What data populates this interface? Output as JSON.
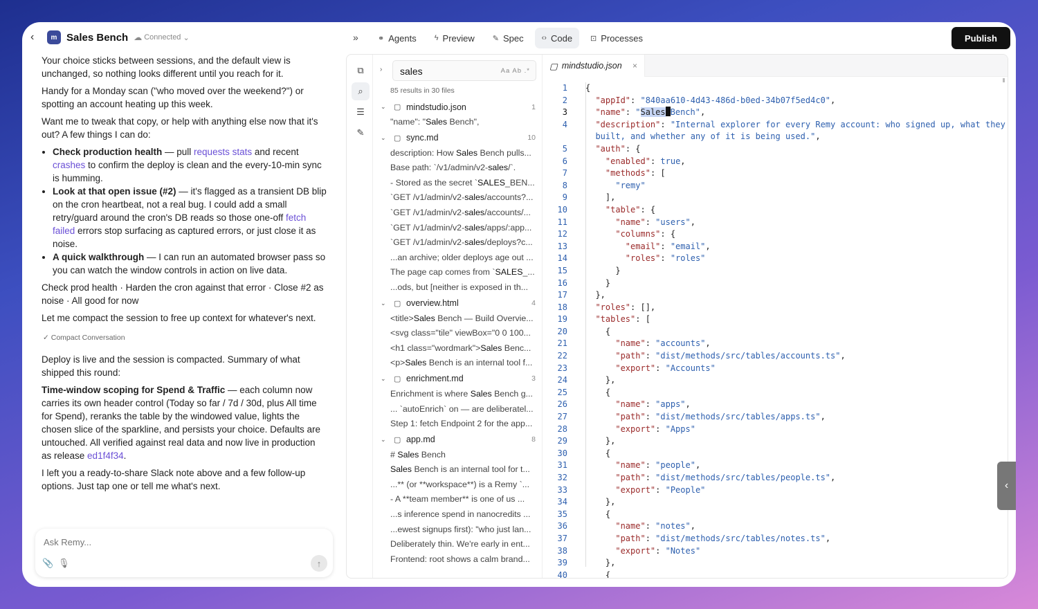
{
  "header": {
    "app_name": "Sales Bench",
    "status": "Connected",
    "logo_text": "m"
  },
  "chat": {
    "p1": "Your choice sticks between sessions, and the default view is unchanged, so nothing looks different until you reach for it.",
    "p2": "Handy for a Monday scan (\"who moved over the weekend?\") or spotting an account heating up this week.",
    "p3": "Want me to tweak that copy, or help with anything else now that it's out? A few things I can do:",
    "b1": {
      "bold": "Check production health",
      "t1": " — pull ",
      "link1": "requests stats",
      "t2": " and recent ",
      "link2": "crashes",
      "t3": " to confirm the deploy is clean and the every-10-min sync is humming."
    },
    "b2": {
      "bold": "Look at that open issue (#2)",
      "t1": " — it's flagged as a transient DB blip on the cron heartbeat, not a real bug. I could add a small retry/guard around the cron's DB reads so those one-off ",
      "link1": "fetch failed",
      "t2": " errors stop surfacing as captured errors, or just close it as noise."
    },
    "b3": {
      "bold": "A quick walkthrough",
      "t1": " — I can run an automated browser pass so you can watch the window controls in action on live data."
    },
    "p4": "Check prod health · Harden the cron against that error · Close #2 as noise · All good for now",
    "p5": "Let me compact the session to free up context for whatever's next.",
    "compact_label": "Compact Conversation",
    "p6": "Deploy is live and the session is compacted. Summary of what shipped this round:",
    "p7": {
      "bold": "Time-window scoping for Spend & Traffic",
      "t1": " — each column now carries its own header control (Today so far / 7d / 30d, plus All time for Spend), reranks the table by the windowed value, lights the chosen slice of the sparkline, and persists your choice. Defaults are untouched. All verified against real data and now live in production as release ",
      "link1": "ed1f4f34",
      "t2": "."
    },
    "p8": "I left you a ready-to-share Slack note above and a few follow-up options. Just tap one or tell me what's next.",
    "composer_placeholder": "Ask Remy..."
  },
  "nav": {
    "tabs": [
      {
        "label": "Agents",
        "icon": "agents-icon"
      },
      {
        "label": "Preview",
        "icon": "lightning-icon"
      },
      {
        "label": "Spec",
        "icon": "pencil-square-icon"
      },
      {
        "label": "Code",
        "icon": "code-icon"
      },
      {
        "label": "Processes",
        "icon": "cpu-icon"
      }
    ],
    "active_tab": "Code",
    "publish_label": "Publish"
  },
  "search": {
    "query": "sales",
    "flags": "Aa  Ab  .*",
    "summary": "85 results in 30 files",
    "files": [
      {
        "name": "mindstudio.json",
        "count": "1",
        "lines": [
          [
            "\"name\": \"",
            "Sales",
            " Bench\","
          ]
        ]
      },
      {
        "name": "sync.md",
        "count": "10",
        "lines": [
          [
            "description: How ",
            "Sales",
            " Bench pulls..."
          ],
          [
            "Base path: `/v1/admin/v2-",
            "sales",
            "/`."
          ],
          [
            "- Stored as the secret `",
            "SALES",
            "_BEN..."
          ],
          [
            "`GET /v1/admin/v2-",
            "sales",
            "/accounts?..."
          ],
          [
            "`GET /v1/admin/v2-",
            "sales",
            "/accounts/..."
          ],
          [
            "`GET /v1/admin/v2-",
            "sales",
            "/apps/:app..."
          ],
          [
            "`GET /v1/admin/v2-",
            "sales",
            "/deploys?c..."
          ],
          [
            "...an archive; older deploys age out ...",
            "",
            ""
          ],
          [
            "The page cap comes from `",
            "SALES",
            "_..."
          ],
          [
            "...ods, but [neither is exposed in th...",
            "",
            ""
          ]
        ]
      },
      {
        "name": "overview.html",
        "count": "4",
        "lines": [
          [
            "<title>",
            "Sales",
            " Bench — Build Overvie..."
          ],
          [
            "<svg class=\"tile\" viewBox=\"0 0 100...",
            "",
            ""
          ],
          [
            "<h1 class=\"wordmark\">",
            "Sales",
            " Benc..."
          ],
          [
            "<p>",
            "Sales",
            " Bench is an internal tool f..."
          ]
        ]
      },
      {
        "name": "enrichment.md",
        "count": "3",
        "lines": [
          [
            "Enrichment is where ",
            "Sales",
            " Bench g..."
          ],
          [
            "... `autoEnrich` on — are deliberatel...",
            "",
            ""
          ],
          [
            "Step 1: fetch Endpoint 2 for the app...",
            "",
            ""
          ]
        ]
      },
      {
        "name": "app.md",
        "count": "8",
        "lines": [
          [
            "# ",
            "Sales",
            " Bench"
          ],
          [
            "",
            "Sales",
            " Bench is an internal tool for t..."
          ],
          [
            "...** (or **workspace**) is a Remy `...",
            "",
            ""
          ],
          [
            "- A **team member** is one of us ...",
            "",
            ""
          ],
          [
            "...s inference spend in nanocredits ...",
            "",
            ""
          ],
          [
            "...ewest signups first): \"who just lan...",
            "",
            ""
          ],
          [
            "Deliberately thin. We're early in ent...",
            "",
            ""
          ],
          [
            "Frontend: root shows a calm brand...",
            "",
            ""
          ]
        ]
      }
    ]
  },
  "editor": {
    "tab_name": "mindstudio.json",
    "lines": [
      {
        "n": "1",
        "segs": [
          [
            "p",
            "{"
          ]
        ]
      },
      {
        "n": "2",
        "segs": [
          [
            "p",
            "  "
          ],
          [
            "k",
            "\"appId\""
          ],
          [
            "p",
            ": "
          ],
          [
            "s",
            "\"840aa610-4d43-486d-b0ed-34b07f5ed4c0\""
          ],
          [
            "p",
            ","
          ]
        ]
      },
      {
        "n": "3",
        "cur": true,
        "segs": [
          [
            "p",
            "  "
          ],
          [
            "k",
            "\"name\""
          ],
          [
            "p",
            ": "
          ],
          [
            "s",
            "\""
          ],
          [
            "hl",
            "Sales"
          ],
          [
            "caret",
            ""
          ],
          [
            "s",
            "Bench\""
          ],
          [
            "p",
            ","
          ]
        ]
      },
      {
        "n": "4",
        "segs": [
          [
            "p",
            "  "
          ],
          [
            "k",
            "\"description\""
          ],
          [
            "p",
            ": "
          ],
          [
            "s",
            "\"Internal explorer for every Remy account: who signed up, what they"
          ]
        ]
      },
      {
        "n": "",
        "segs": [
          [
            "s",
            "  built, and whether any of it is being used.\""
          ],
          [
            "p",
            ","
          ]
        ]
      },
      {
        "n": "5",
        "segs": [
          [
            "p",
            "  "
          ],
          [
            "k",
            "\"auth\""
          ],
          [
            "p",
            ": {"
          ]
        ]
      },
      {
        "n": "6",
        "segs": [
          [
            "p",
            "    "
          ],
          [
            "k",
            "\"enabled\""
          ],
          [
            "p",
            ": "
          ],
          [
            "s",
            "true"
          ],
          [
            "p",
            ","
          ]
        ]
      },
      {
        "n": "7",
        "segs": [
          [
            "p",
            "    "
          ],
          [
            "k",
            "\"methods\""
          ],
          [
            "p",
            ": ["
          ]
        ]
      },
      {
        "n": "8",
        "segs": [
          [
            "p",
            "      "
          ],
          [
            "s",
            "\"remy\""
          ]
        ]
      },
      {
        "n": "9",
        "segs": [
          [
            "p",
            "    ],"
          ]
        ]
      },
      {
        "n": "10",
        "segs": [
          [
            "p",
            "    "
          ],
          [
            "k",
            "\"table\""
          ],
          [
            "p",
            ": {"
          ]
        ]
      },
      {
        "n": "11",
        "segs": [
          [
            "p",
            "      "
          ],
          [
            "k",
            "\"name\""
          ],
          [
            "p",
            ": "
          ],
          [
            "s",
            "\"users\""
          ],
          [
            "p",
            ","
          ]
        ]
      },
      {
        "n": "12",
        "segs": [
          [
            "p",
            "      "
          ],
          [
            "k",
            "\"columns\""
          ],
          [
            "p",
            ": {"
          ]
        ]
      },
      {
        "n": "13",
        "segs": [
          [
            "p",
            "        "
          ],
          [
            "k",
            "\"email\""
          ],
          [
            "p",
            ": "
          ],
          [
            "s",
            "\"email\""
          ],
          [
            "p",
            ","
          ]
        ]
      },
      {
        "n": "14",
        "segs": [
          [
            "p",
            "        "
          ],
          [
            "k",
            "\"roles\""
          ],
          [
            "p",
            ": "
          ],
          [
            "s",
            "\"roles\""
          ]
        ]
      },
      {
        "n": "15",
        "segs": [
          [
            "p",
            "      }"
          ]
        ]
      },
      {
        "n": "16",
        "segs": [
          [
            "p",
            "    }"
          ]
        ]
      },
      {
        "n": "17",
        "segs": [
          [
            "p",
            "  },"
          ]
        ]
      },
      {
        "n": "18",
        "segs": [
          [
            "p",
            "  "
          ],
          [
            "k",
            "\"roles\""
          ],
          [
            "p",
            ": [],"
          ]
        ]
      },
      {
        "n": "19",
        "segs": [
          [
            "p",
            "  "
          ],
          [
            "k",
            "\"tables\""
          ],
          [
            "p",
            ": ["
          ]
        ]
      },
      {
        "n": "20",
        "segs": [
          [
            "p",
            "    {"
          ]
        ]
      },
      {
        "n": "21",
        "segs": [
          [
            "p",
            "      "
          ],
          [
            "k",
            "\"name\""
          ],
          [
            "p",
            ": "
          ],
          [
            "s",
            "\"accounts\""
          ],
          [
            "p",
            ","
          ]
        ]
      },
      {
        "n": "22",
        "segs": [
          [
            "p",
            "      "
          ],
          [
            "k",
            "\"path\""
          ],
          [
            "p",
            ": "
          ],
          [
            "s",
            "\"dist/methods/src/tables/accounts.ts\""
          ],
          [
            "p",
            ","
          ]
        ]
      },
      {
        "n": "23",
        "segs": [
          [
            "p",
            "      "
          ],
          [
            "k",
            "\"export\""
          ],
          [
            "p",
            ": "
          ],
          [
            "s",
            "\"Accounts\""
          ]
        ]
      },
      {
        "n": "24",
        "segs": [
          [
            "p",
            "    },"
          ]
        ]
      },
      {
        "n": "25",
        "segs": [
          [
            "p",
            "    {"
          ]
        ]
      },
      {
        "n": "26",
        "segs": [
          [
            "p",
            "      "
          ],
          [
            "k",
            "\"name\""
          ],
          [
            "p",
            ": "
          ],
          [
            "s",
            "\"apps\""
          ],
          [
            "p",
            ","
          ]
        ]
      },
      {
        "n": "27",
        "segs": [
          [
            "p",
            "      "
          ],
          [
            "k",
            "\"path\""
          ],
          [
            "p",
            ": "
          ],
          [
            "s",
            "\"dist/methods/src/tables/apps.ts\""
          ],
          [
            "p",
            ","
          ]
        ]
      },
      {
        "n": "28",
        "segs": [
          [
            "p",
            "      "
          ],
          [
            "k",
            "\"export\""
          ],
          [
            "p",
            ": "
          ],
          [
            "s",
            "\"Apps\""
          ]
        ]
      },
      {
        "n": "29",
        "segs": [
          [
            "p",
            "    },"
          ]
        ]
      },
      {
        "n": "30",
        "segs": [
          [
            "p",
            "    {"
          ]
        ]
      },
      {
        "n": "31",
        "segs": [
          [
            "p",
            "      "
          ],
          [
            "k",
            "\"name\""
          ],
          [
            "p",
            ": "
          ],
          [
            "s",
            "\"people\""
          ],
          [
            "p",
            ","
          ]
        ]
      },
      {
        "n": "32",
        "segs": [
          [
            "p",
            "      "
          ],
          [
            "k",
            "\"path\""
          ],
          [
            "p",
            ": "
          ],
          [
            "s",
            "\"dist/methods/src/tables/people.ts\""
          ],
          [
            "p",
            ","
          ]
        ]
      },
      {
        "n": "33",
        "segs": [
          [
            "p",
            "      "
          ],
          [
            "k",
            "\"export\""
          ],
          [
            "p",
            ": "
          ],
          [
            "s",
            "\"People\""
          ]
        ]
      },
      {
        "n": "34",
        "segs": [
          [
            "p",
            "    },"
          ]
        ]
      },
      {
        "n": "35",
        "segs": [
          [
            "p",
            "    {"
          ]
        ]
      },
      {
        "n": "36",
        "segs": [
          [
            "p",
            "      "
          ],
          [
            "k",
            "\"name\""
          ],
          [
            "p",
            ": "
          ],
          [
            "s",
            "\"notes\""
          ],
          [
            "p",
            ","
          ]
        ]
      },
      {
        "n": "37",
        "segs": [
          [
            "p",
            "      "
          ],
          [
            "k",
            "\"path\""
          ],
          [
            "p",
            ": "
          ],
          [
            "s",
            "\"dist/methods/src/tables/notes.ts\""
          ],
          [
            "p",
            ","
          ]
        ]
      },
      {
        "n": "38",
        "segs": [
          [
            "p",
            "      "
          ],
          [
            "k",
            "\"export\""
          ],
          [
            "p",
            ": "
          ],
          [
            "s",
            "\"Notes\""
          ]
        ]
      },
      {
        "n": "39",
        "segs": [
          [
            "p",
            "    },"
          ]
        ]
      },
      {
        "n": "40",
        "segs": [
          [
            "p",
            "    {"
          ]
        ]
      }
    ]
  }
}
